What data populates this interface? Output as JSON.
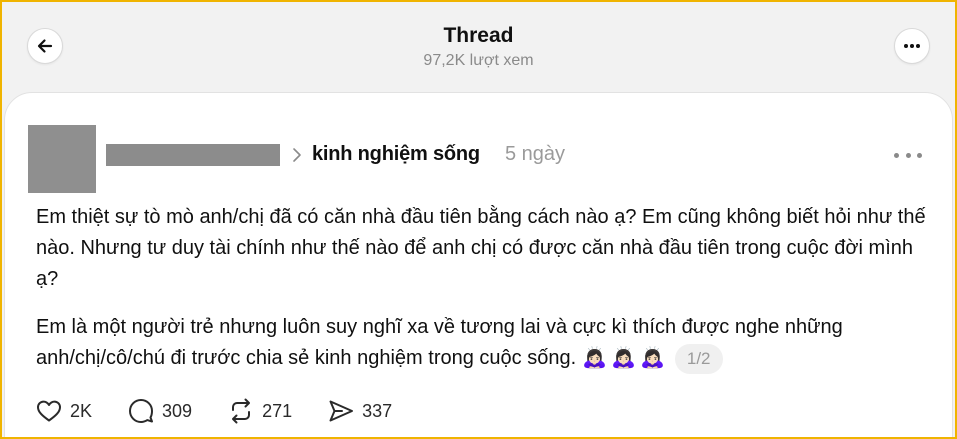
{
  "header": {
    "title": "Thread",
    "views": "97,2K lượt xem"
  },
  "post": {
    "topic": "kinh nghiệm sống",
    "time": "5 ngày",
    "paragraph1": "Em thiệt sự tò mò anh/chị đã có căn nhà đầu tiên bằng cách nào ạ? Em cũng không biết hỏi như thế nào. Nhưng tư duy tài chính như thế nào để anh chị có được căn nhà đầu tiên trong cuộc đời mình ạ?",
    "paragraph2": "Em là một người trẻ nhưng luôn suy nghĩ xa về tương lai và cực kì thích được nghe những anh/chị/cô/chú đi trước chia sẻ kinh nghiệm trong cuộc sống.",
    "emojis": "🙇🏻‍♀️🙇🏻‍♀️🙇🏻‍♀️",
    "page_indicator": "1/2"
  },
  "actions": {
    "likes": "2K",
    "comments": "309",
    "reposts": "271",
    "shares": "337"
  },
  "icons": [
    "back-arrow-icon",
    "more-icon",
    "chevron-right-icon",
    "heart-icon",
    "comment-icon",
    "repost-icon",
    "share-icon"
  ],
  "colors": {
    "frame": "#f0b400",
    "background": "#f2f2f2",
    "card": "#ffffff",
    "muted": "#8a8a8a"
  }
}
